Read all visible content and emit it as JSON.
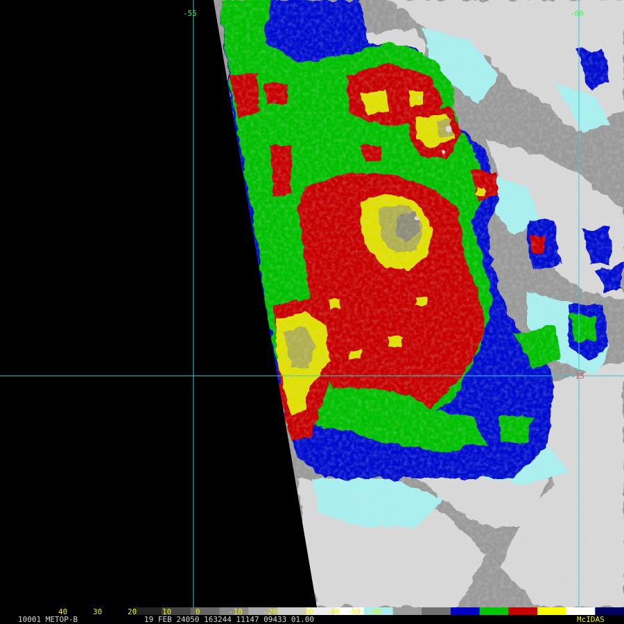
{
  "image": {
    "satellite_info": "10001 METOP-B",
    "date_time_info": "19 FEB 24050 163244 11147 09433 01.00",
    "software_label": "McIDAS"
  },
  "grid": {
    "color": "#33c8d8",
    "lon_label_left": "-55",
    "lon_label_right": "-60",
    "lat_label": "-15"
  },
  "color_bar": {
    "scale_labels": [
      "40",
      "30",
      "20",
      "10",
      "0",
      "-10",
      "-20",
      "-30",
      "-40",
      "-50",
      "-60"
    ],
    "segment_colors": [
      "#000000",
      "#222222",
      "#444444",
      "#666666",
      "#888888",
      "#aaaaaa",
      "#cccccc",
      "#eeeeee",
      "#ffffff",
      "#a8f0f0",
      "#9c9c9c",
      "#707070",
      "#0000c8",
      "#00c800",
      "#c80000",
      "#ffff00",
      "#ffffff",
      "#000060"
    ]
  },
  "palette": {
    "swath_gap": "#000000",
    "clear_sky": "#9a9a9a",
    "low_cloud": "#d8d8d8",
    "cyan_band": "#a8f0f0",
    "blue_band": "#0010d0",
    "green_band": "#00c000",
    "red_band": "#c80000",
    "yellow_band": "#e0e000",
    "olive_band": "#b0b050",
    "gray_core": "#8c8c78"
  }
}
